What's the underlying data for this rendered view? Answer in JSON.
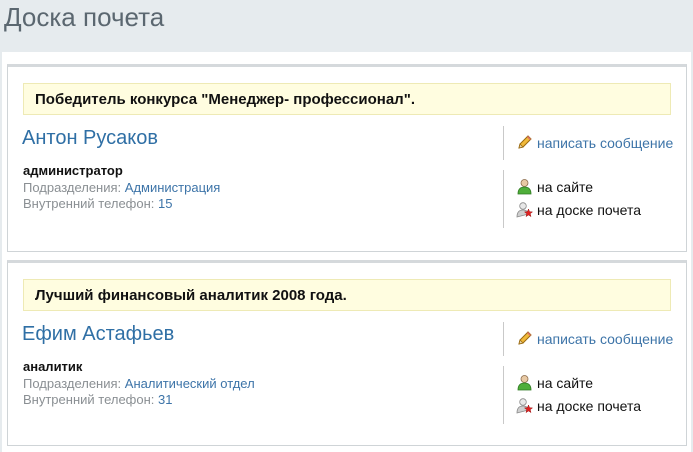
{
  "page": {
    "title": "Доска почета"
  },
  "labels": {
    "dept_label": "Подразделения:",
    "phone_label": "Внутренний телефон:",
    "write_message": "написать сообщение",
    "online": "на сайте",
    "honor_board": "на доске почета"
  },
  "entries": [
    {
      "award": "Победитель конкурса \"Менеджер- профессионал\".",
      "name": "Антон Русаков",
      "position": "администратор",
      "department": "Администрация",
      "phone": "15"
    },
    {
      "award": "Лучший финансовый аналитик 2008 года.",
      "name": "Ефим Астафьев",
      "position": "аналитик",
      "department": "Аналитический отдел",
      "phone": "31"
    }
  ]
}
